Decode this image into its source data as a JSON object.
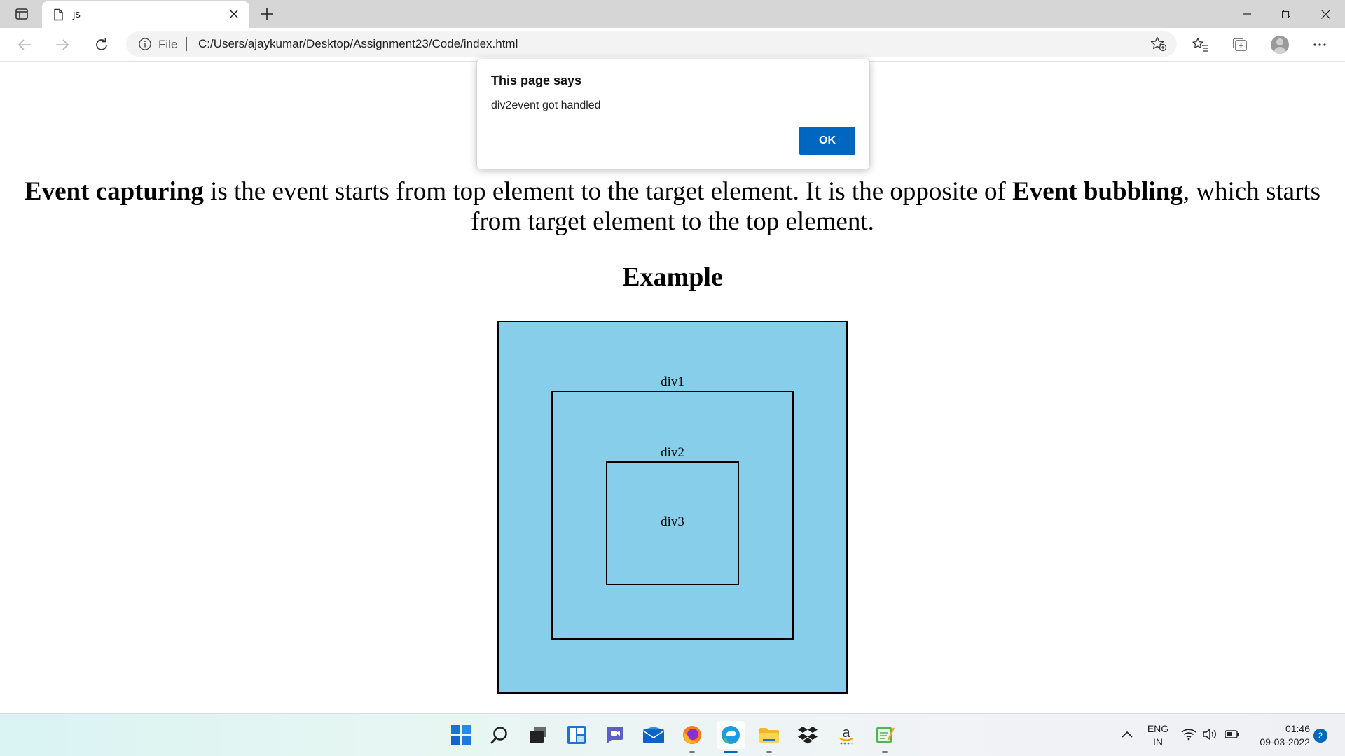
{
  "browser": {
    "tab_title": "js",
    "address_scheme_label": "File",
    "url": "C:/Users/ajaykumar/Desktop/Assignment23/Code/index.html"
  },
  "page": {
    "intro": {
      "term1": "Event capturing",
      "text1": " is the event starts from top element to the target element. It is the opposite of ",
      "term2": "Event bubbling",
      "text2": ", which starts from target element to the top element."
    },
    "example_heading": "Example",
    "boxes": {
      "div1_label": "div1",
      "div2_label": "div2",
      "div3_label": "div3",
      "fill_color": "#87ceeb"
    }
  },
  "alert": {
    "title": "This page says",
    "message": "div2event got handled",
    "ok_label": "OK",
    "button_color": "#0067c0"
  },
  "taskbar": {
    "icons": [
      "start-icon",
      "search-icon",
      "task-view-icon",
      "widgets-icon",
      "chat-icon",
      "mail-icon",
      "firefox-icon",
      "edge-icon",
      "file-explorer-icon",
      "dropbox-icon",
      "amazon-icon",
      "notepad-icon"
    ],
    "lang_line1": "ENG",
    "lang_line2": "IN",
    "time": "01:46",
    "date": "09-03-2022",
    "notification_count": "2"
  }
}
